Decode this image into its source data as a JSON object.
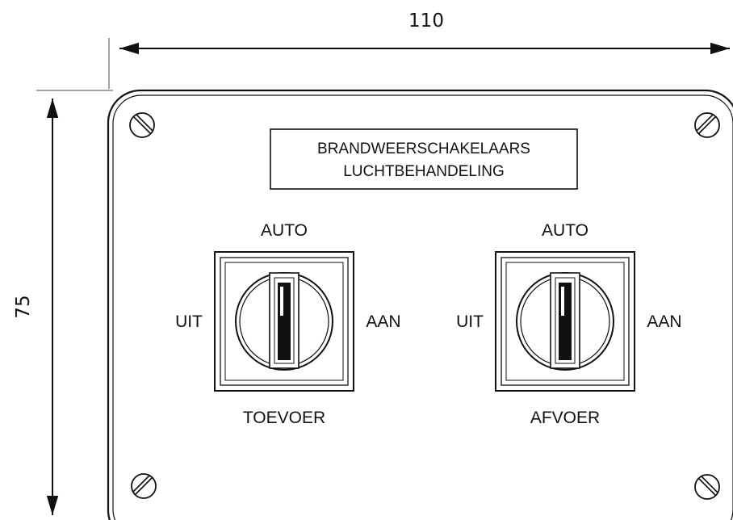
{
  "dimensions": {
    "width_label": "110",
    "height_label": "75"
  },
  "title_box": {
    "line1": "BRANDWEERSCHAKELAARS",
    "line2": "LUCHTBEHANDELING"
  },
  "switches": [
    {
      "top_label": "AUTO",
      "left_label": "UIT",
      "right_label": "AAN",
      "bottom_label": "TOEVOER"
    },
    {
      "top_label": "AUTO",
      "left_label": "UIT",
      "right_label": "AAN",
      "bottom_label": "AFVOER"
    }
  ]
}
